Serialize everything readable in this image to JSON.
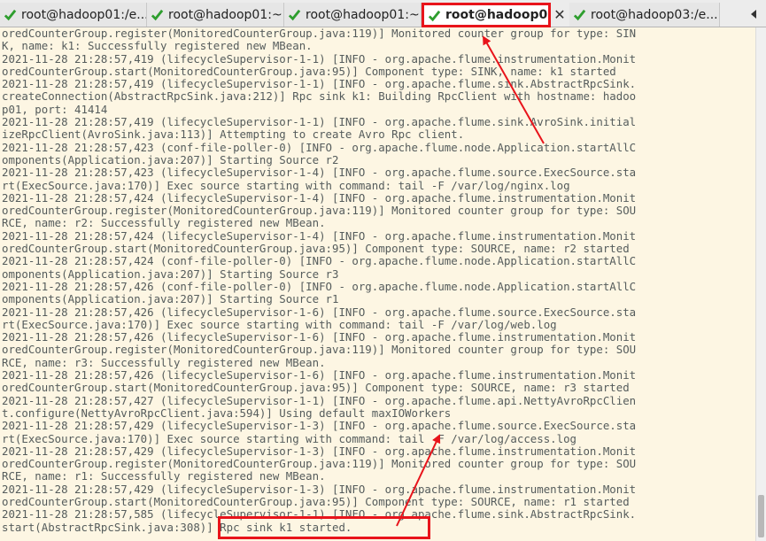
{
  "tabs": [
    {
      "label": "root@hadoop01:/e...",
      "active": false
    },
    {
      "label": "root@hadoop01:~",
      "active": false
    },
    {
      "label": "root@hadoop01:~",
      "active": false
    },
    {
      "label": "root@hadoop0...",
      "active": true
    },
    {
      "label": "root@hadoop03:/e...",
      "active": false
    }
  ],
  "tab_close_icon": "close-icon",
  "tab_scroll_icon": "chevron-left-icon",
  "colors": {
    "terminal_bg": "#fdf6e3",
    "terminal_text": "#555c5c",
    "annotation_red": "#e8141b",
    "tab_check_green": "#2e9e2e"
  },
  "terminal": {
    "lines": [
      "oredCounterGroup.register(MonitoredCounterGroup.java:119)] Monitored counter group for type: SIN",
      "K, name: k1: Successfully registered new MBean.",
      "2021-11-28 21:28:57,419 (lifecycleSupervisor-1-1) [INFO - org.apache.flume.instrumentation.Monit",
      "oredCounterGroup.start(MonitoredCounterGroup.java:95)] Component type: SINK, name: k1 started",
      "2021-11-28 21:28:57,419 (lifecycleSupervisor-1-1) [INFO - org.apache.flume.sink.AbstractRpcSink.",
      "createConnection(AbstractRpcSink.java:212)] Rpc sink k1: Building RpcClient with hostname: hadoo",
      "p01, port: 41414",
      "2021-11-28 21:28:57,419 (lifecycleSupervisor-1-1) [INFO - org.apache.flume.sink.AvroSink.initial",
      "izeRpcClient(AvroSink.java:113)] Attempting to create Avro Rpc client.",
      "2021-11-28 21:28:57,423 (conf-file-poller-0) [INFO - org.apache.flume.node.Application.startAllC",
      "omponents(Application.java:207)] Starting Source r2",
      "2021-11-28 21:28:57,423 (lifecycleSupervisor-1-4) [INFO - org.apache.flume.source.ExecSource.sta",
      "rt(ExecSource.java:170)] Exec source starting with command: tail -F /var/log/nginx.log",
      "2021-11-28 21:28:57,424 (lifecycleSupervisor-1-4) [INFO - org.apache.flume.instrumentation.Monit",
      "oredCounterGroup.register(MonitoredCounterGroup.java:119)] Monitored counter group for type: SOU",
      "RCE, name: r2: Successfully registered new MBean.",
      "2021-11-28 21:28:57,424 (lifecycleSupervisor-1-4) [INFO - org.apache.flume.instrumentation.Monit",
      "oredCounterGroup.start(MonitoredCounterGroup.java:95)] Component type: SOURCE, name: r2 started",
      "2021-11-28 21:28:57,424 (conf-file-poller-0) [INFO - org.apache.flume.node.Application.startAllC",
      "omponents(Application.java:207)] Starting Source r3",
      "2021-11-28 21:28:57,426 (conf-file-poller-0) [INFO - org.apache.flume.node.Application.startAllC",
      "omponents(Application.java:207)] Starting Source r1",
      "2021-11-28 21:28:57,426 (lifecycleSupervisor-1-6) [INFO - org.apache.flume.source.ExecSource.sta",
      "rt(ExecSource.java:170)] Exec source starting with command: tail -F /var/log/web.log",
      "2021-11-28 21:28:57,426 (lifecycleSupervisor-1-6) [INFO - org.apache.flume.instrumentation.Monit",
      "oredCounterGroup.register(MonitoredCounterGroup.java:119)] Monitored counter group for type: SOU",
      "RCE, name: r3: Successfully registered new MBean.",
      "2021-11-28 21:28:57,426 (lifecycleSupervisor-1-6) [INFO - org.apache.flume.instrumentation.Monit",
      "oredCounterGroup.start(MonitoredCounterGroup.java:95)] Component type: SOURCE, name: r3 started",
      "2021-11-28 21:28:57,427 (lifecycleSupervisor-1-1) [INFO - org.apache.flume.api.NettyAvroRpcClien",
      "t.configure(NettyAvroRpcClient.java:594)] Using default maxIOWorkers",
      "2021-11-28 21:28:57,429 (lifecycleSupervisor-1-3) [INFO - org.apache.flume.source.ExecSource.sta",
      "rt(ExecSource.java:170)] Exec source starting with command: tail -F /var/log/access.log",
      "2021-11-28 21:28:57,429 (lifecycleSupervisor-1-3) [INFO - org.apache.flume.instrumentation.Monit",
      "oredCounterGroup.register(MonitoredCounterGroup.java:119)] Monitored counter group for type: SOU",
      "RCE, name: r1: Successfully registered new MBean.",
      "2021-11-28 21:28:57,429 (lifecycleSupervisor-1-3) [INFO - org.apache.flume.instrumentation.Monit",
      "oredCounterGroup.start(MonitoredCounterGroup.java:95)] Component type: SOURCE, name: r1 started",
      "2021-11-28 21:28:57,585 (lifecycleSupervisor-1-1) [INFO - org.apache.flume.sink.AbstractRpcSink.",
      "start(AbstractRpcSink.java:308)] Rpc sink k1 started."
    ]
  }
}
